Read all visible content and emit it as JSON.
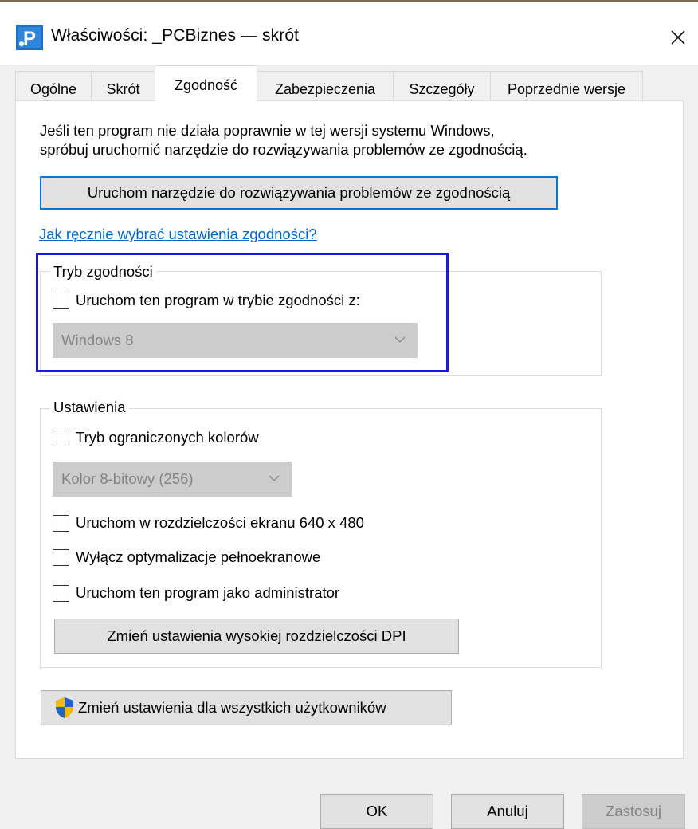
{
  "window": {
    "title": "Właściwości: _PCBiznes — skrót",
    "app_icon": "pcbiznes-app-icon",
    "close_icon": "close-icon"
  },
  "tabs": [
    {
      "label": "Ogólne",
      "active": false
    },
    {
      "label": "Skrót",
      "active": false
    },
    {
      "label": "Zgodność",
      "active": true
    },
    {
      "label": "Zabezpieczenia",
      "active": false
    },
    {
      "label": "Szczegóły",
      "active": false
    },
    {
      "label": "Poprzednie wersje",
      "active": false
    }
  ],
  "compat": {
    "info_line1": "Jeśli ten program nie działa poprawnie w tej wersji systemu Windows,",
    "info_line2": "spróbuj uruchomić narzędzie do rozwiązywania problemów ze zgodnością.",
    "troubleshooter_button": "Uruchom narzędzie do rozwiązywania problemów ze zgodnością",
    "manual_link": "Jak ręcznie wybrać ustawienia zgodności?",
    "mode_group": {
      "legend": "Tryb zgodności",
      "checkbox_label": "Uruchom ten program w trybie zgodności z:",
      "checked": false,
      "os_select_value": "Windows 8",
      "highlight_color": "#1a1ad8"
    },
    "settings_group": {
      "legend": "Ustawienia",
      "reduced_color_label": "Tryb ograniczonych kolorów",
      "reduced_color_checked": false,
      "color_select_value": "Kolor 8-bitowy (256)",
      "resolution_label": "Uruchom w rozdzielczości ekranu 640 x 480",
      "resolution_checked": false,
      "fullscreen_opt_label": "Wyłącz optymalizacje pełnoekranowe",
      "fullscreen_opt_checked": false,
      "admin_label": "Uruchom ten program jako administrator",
      "admin_checked": false,
      "dpi_button": "Zmień ustawienia wysokiej rozdzielczości DPI"
    },
    "all_users_button": "Zmień ustawienia dla wszystkich użytkowników",
    "all_users_icon": "uac-shield-icon"
  },
  "footer": {
    "ok": "OK",
    "cancel": "Anuluj",
    "apply": "Zastosuj",
    "apply_enabled": false
  }
}
